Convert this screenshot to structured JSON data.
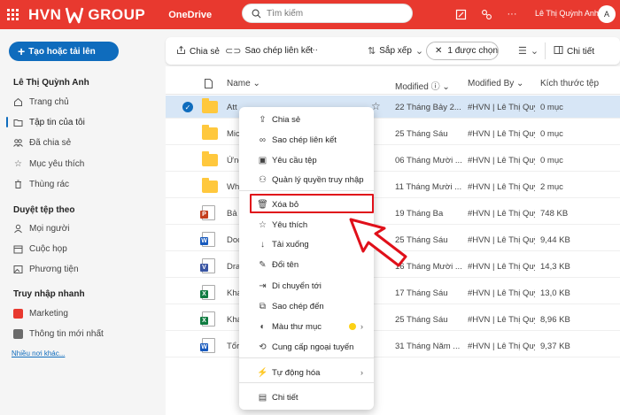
{
  "topbar": {
    "brand_left": "HVN",
    "brand_right": "GROUP",
    "app_name": "OneDrive",
    "search_placeholder": "Tìm kiếm",
    "user_name": "Lê Thị Quỳnh Anh",
    "avatar_initial": "A",
    "accent_color": "#e8392f"
  },
  "sidebar": {
    "create_label": "Tạo hoặc tải lên",
    "user_section": "Lê Thị Quỳnh Anh",
    "items": [
      {
        "label": "Trang chủ",
        "icon": "home-icon"
      },
      {
        "label": "Tập tin của tôi",
        "icon": "folder-icon"
      },
      {
        "label": "Đã chia sẻ",
        "icon": "people-icon"
      },
      {
        "label": "Mục yêu thích",
        "icon": "star-icon"
      },
      {
        "label": "Thùng rác",
        "icon": "trash-icon"
      }
    ],
    "browse_section": "Duyệt tệp theo",
    "browse_items": [
      {
        "label": "Mọi người",
        "icon": "person-icon"
      },
      {
        "label": "Cuộc họp",
        "icon": "calendar-icon"
      },
      {
        "label": "Phương tiện",
        "icon": "image-icon"
      }
    ],
    "quick_section": "Truy nhập nhanh",
    "quick_items": [
      {
        "label": "Marketing",
        "color": "#e8392f"
      },
      {
        "label": "Thông tin mới nhất",
        "color": "#6b6b6b"
      }
    ],
    "more_link": "Nhiều nơi khác..."
  },
  "commandbar": {
    "share": "Chia sẻ",
    "copy_link": "Sao chép liên kết",
    "more": "···",
    "sort": "Sắp xếp",
    "selected": "1 được chọn",
    "details": "Chi tiết"
  },
  "columns": {
    "name": "Name",
    "modified": "Modified",
    "modified_by": "Modified By",
    "size": "Kích thước tệp"
  },
  "files": [
    {
      "name": "Att",
      "type": "folder",
      "modified": "22 Tháng Bảy 2...",
      "by": "#HVN | Lê Thị Quỳnh",
      "size": "0 mục"
    },
    {
      "name": "Mic",
      "type": "folder",
      "modified": "25 Tháng Sáu",
      "by": "#HVN | Lê Thị Quỳnh",
      "size": "0 mục"
    },
    {
      "name": "Ứng",
      "type": "folder",
      "modified": "06 Tháng Mười ...",
      "by": "#HVN | Lê Thị Quỳnh",
      "size": "0 mục"
    },
    {
      "name": "Wh",
      "type": "folder",
      "modified": "11 Tháng Mười ...",
      "by": "#HVN | Lê Thị Quỳnh",
      "size": "2 mục"
    },
    {
      "name": "Bả",
      "type": "ppt",
      "modified": "19 Tháng Ba",
      "by": "#HVN | Lê Thị Quỳnh",
      "size": "748 KB"
    },
    {
      "name": "Doc",
      "type": "word",
      "modified": "25 Tháng Sáu",
      "by": "#HVN | Lê Thị Quỳnh",
      "size": "9,44 KB"
    },
    {
      "name": "Dra",
      "type": "visio",
      "modified": "16 Tháng Mười ...",
      "by": "#HVN | Lê Thị Quỳnh",
      "size": "14,3 KB"
    },
    {
      "name": "Khá",
      "type": "excel",
      "modified": "17 Tháng Sáu",
      "by": "#HVN | Lê Thị Quỳnh",
      "size": "13,0 KB"
    },
    {
      "name": "Khá",
      "type": "excel",
      "modified": "25 Tháng Sáu",
      "by": "#HVN | Lê Thị Quỳnh",
      "size": "8,96 KB"
    },
    {
      "name": "Tổr",
      "type": "word",
      "modified": "31 Tháng Năm ...",
      "by": "#HVN | Lê Thị Quỳnh",
      "size": "9,37 KB"
    }
  ],
  "context_menu": {
    "items": [
      {
        "label": "Chia sẻ",
        "icon": "share-icon"
      },
      {
        "label": "Sao chép liên kết",
        "icon": "link-icon"
      },
      {
        "label": "Yêu cầu tệp",
        "icon": "request-file-icon"
      },
      {
        "label": "Quản lý quyền truy nhập",
        "icon": "manage-access-icon"
      },
      {
        "label": "Xóa bỏ",
        "icon": "trash-icon"
      },
      {
        "label": "Yêu thích",
        "icon": "star-icon"
      },
      {
        "label": "Tải xuống",
        "icon": "download-icon"
      },
      {
        "label": "Đổi tên",
        "icon": "rename-icon"
      },
      {
        "label": "Di chuyển tới",
        "icon": "move-icon"
      },
      {
        "label": "Sao chép đến",
        "icon": "copy-icon"
      },
      {
        "label": "Màu thư mục",
        "icon": "folder-color-icon"
      },
      {
        "label": "Cung cấp ngoại tuyến",
        "icon": "offline-icon"
      },
      {
        "label": "Tự động hóa",
        "icon": "automate-icon"
      },
      {
        "label": "Chi tiết",
        "icon": "details-icon"
      }
    ],
    "highlight_color": "#e0101a"
  }
}
